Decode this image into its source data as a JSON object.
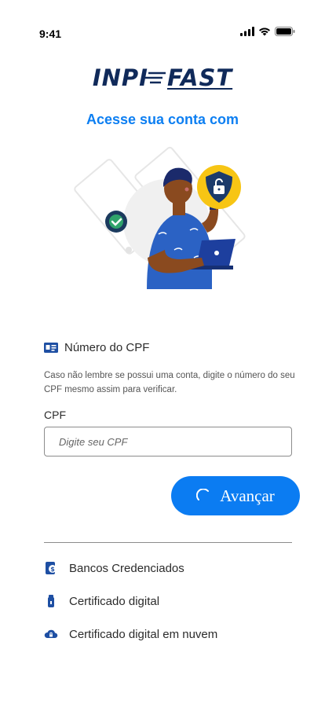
{
  "status_bar": {
    "time": "9:41",
    "icons": [
      "signal-icon",
      "wifi-icon",
      "battery-icon"
    ]
  },
  "logo": {
    "left_text": "INPI",
    "right_text": "FAST"
  },
  "headline": "Acesse sua conta com",
  "illustration": {
    "icons": [
      "lock-shield-icon",
      "check-badge-icon",
      "laptop-icon"
    ]
  },
  "cpf_section": {
    "title": "Número do CPF",
    "helper_text": "Caso não lembre se possui uma conta, digite o número do seu CPF mesmo assim para verificar.",
    "field_label": "CPF",
    "input_value": "",
    "input_placeholder": "Digite seu CPF"
  },
  "next_button": {
    "label": "Avançar"
  },
  "options": [
    {
      "label": "Bancos Credenciados",
      "icon": "bank-icon"
    },
    {
      "label": "Certificado digital",
      "icon": "usb-token-icon"
    },
    {
      "label": "Certificado digital em nuvem",
      "icon": "cloud-lock-icon"
    }
  ],
  "colors": {
    "primary": "#0b7cf2",
    "headline": "#0d7ff2",
    "logo": "#102a5a",
    "icon": "#1e4fa3",
    "lock_badge": "#f7c514"
  }
}
